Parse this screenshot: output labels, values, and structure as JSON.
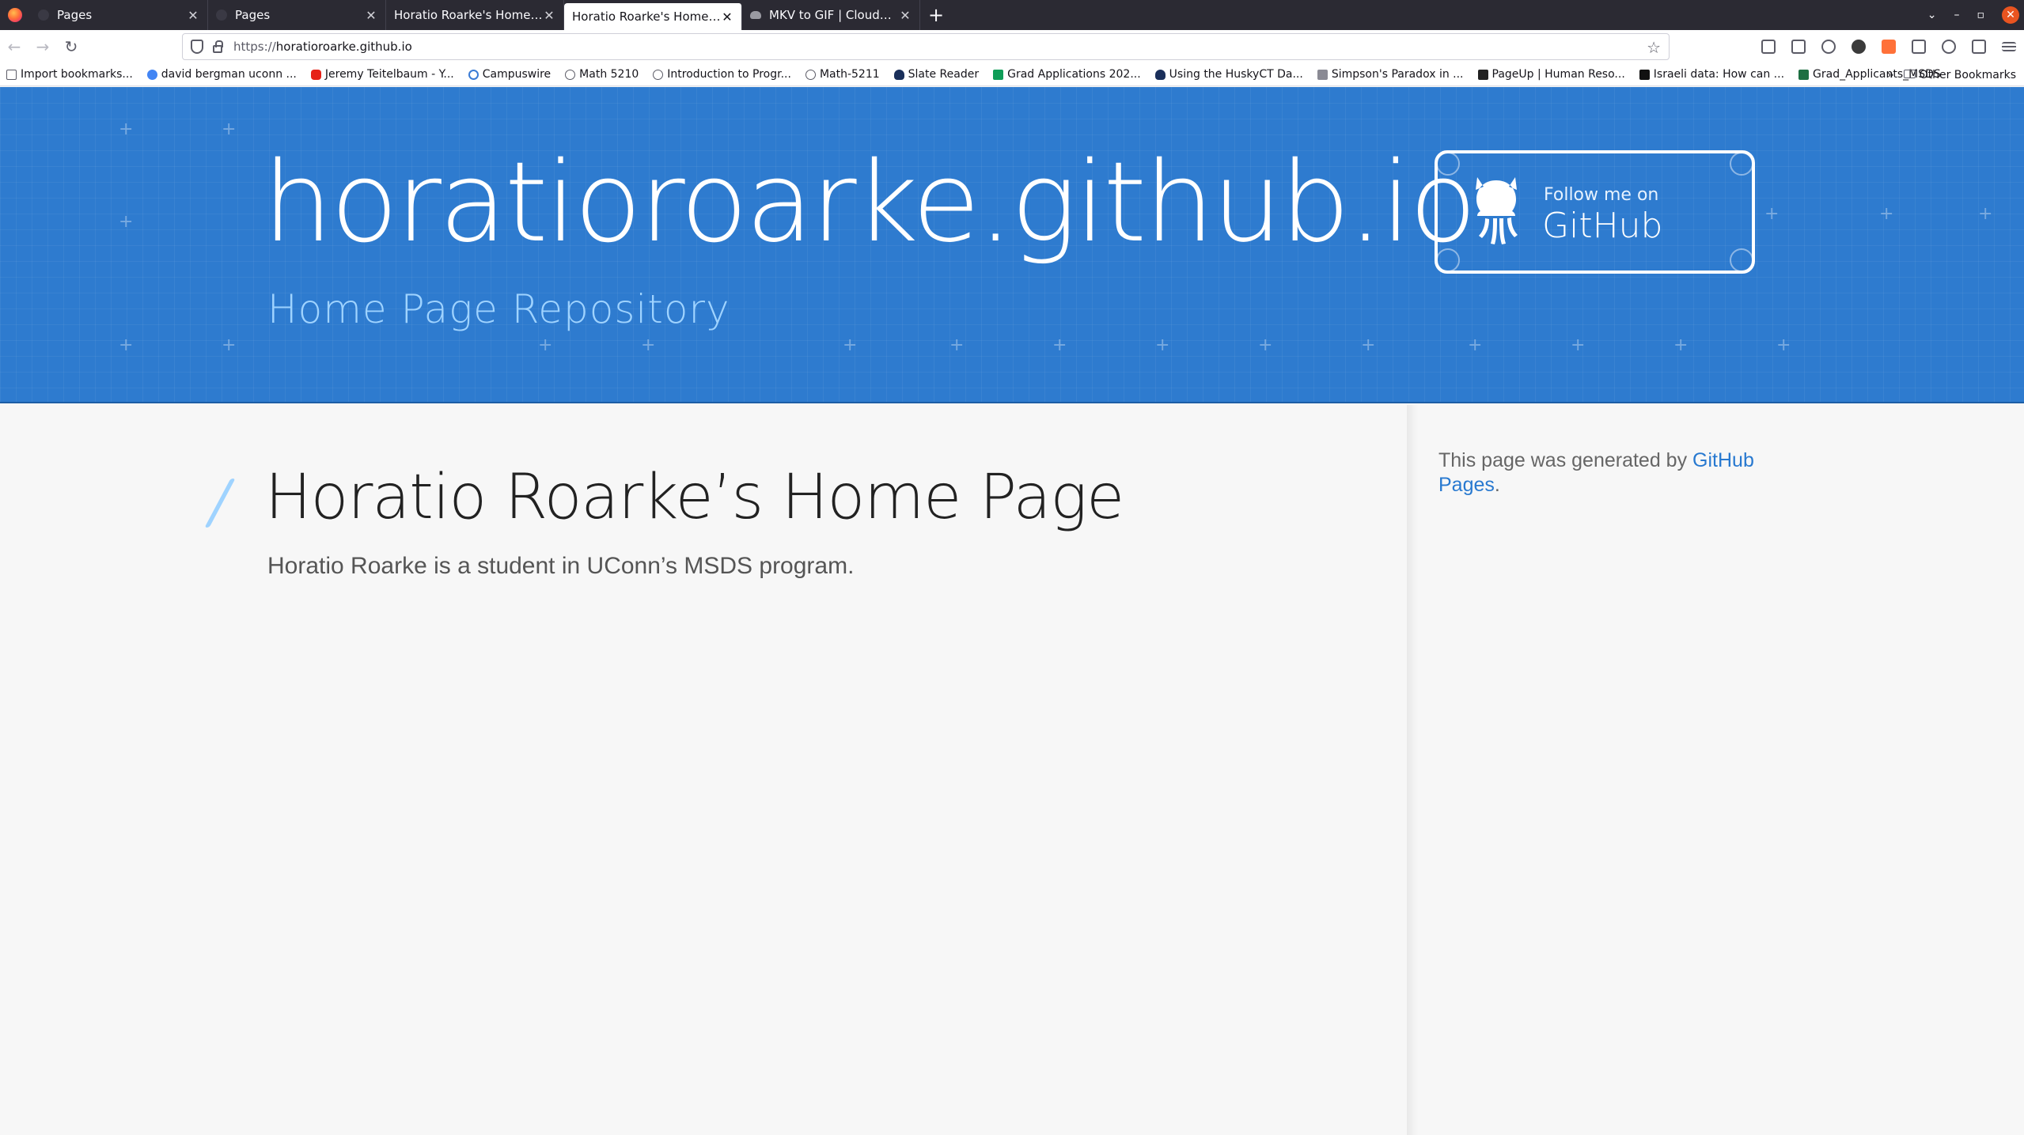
{
  "browser": {
    "tabs": [
      {
        "label": "Pages",
        "active": false
      },
      {
        "label": "Pages",
        "active": false
      },
      {
        "label": "Horatio Roarke's Home Page",
        "active": false
      },
      {
        "label": "Horatio Roarke's Home Page",
        "active": true
      },
      {
        "label": "MKV to GIF | CloudConvert",
        "active": false
      }
    ],
    "new_tab_label": "+",
    "url_protocol": "https://",
    "url_host": "horatioroarke.github.io",
    "bookmarks": [
      {
        "label": "Import bookmarks...",
        "icon": "import-icon"
      },
      {
        "label": "david bergman uconn ...",
        "icon": "google-icon"
      },
      {
        "label": "Jeremy Teitelbaum - Y...",
        "icon": "youtube-icon"
      },
      {
        "label": "Campuswire",
        "icon": "campuswire-icon"
      },
      {
        "label": "Math 5210",
        "icon": "globe-icon"
      },
      {
        "label": "Introduction to Progr...",
        "icon": "globe-icon"
      },
      {
        "label": "Math-5211",
        "icon": "globe-icon"
      },
      {
        "label": "Slate Reader",
        "icon": "uconn-icon"
      },
      {
        "label": "Grad Applications 202...",
        "icon": "sheets-icon"
      },
      {
        "label": "Using the HuskyCT Da...",
        "icon": "uconn-icon"
      },
      {
        "label": "Simpson's Paradox in ...",
        "icon": "page-icon"
      },
      {
        "label": "PageUp | Human Reso...",
        "icon": "pageup-icon"
      },
      {
        "label": "Israeli data: How can ...",
        "icon": "site-icon"
      },
      {
        "label": "Grad_Applicants_MSDS",
        "icon": "excel-icon"
      }
    ],
    "bookmarks_overflow": "»",
    "other_bookmarks": "Other Bookmarks"
  },
  "header": {
    "site_title": "horatioroarke.github.io",
    "subtitle": "Home Page Repository",
    "github_button": {
      "follow_text": "Follow me on",
      "github_text": "GitHub"
    },
    "colors": {
      "background": "#2e7bcf",
      "subtitle": "#9fd3ff"
    }
  },
  "main": {
    "heading": "Horatio Roarke’s Home Page",
    "paragraph": "Horatio Roarke is a student in UConn’s MSDS program."
  },
  "sidebar": {
    "prefix": "This page was generated by ",
    "link_text": "GitHub Pages",
    "suffix": ".",
    "link_color": "#2879d0"
  }
}
